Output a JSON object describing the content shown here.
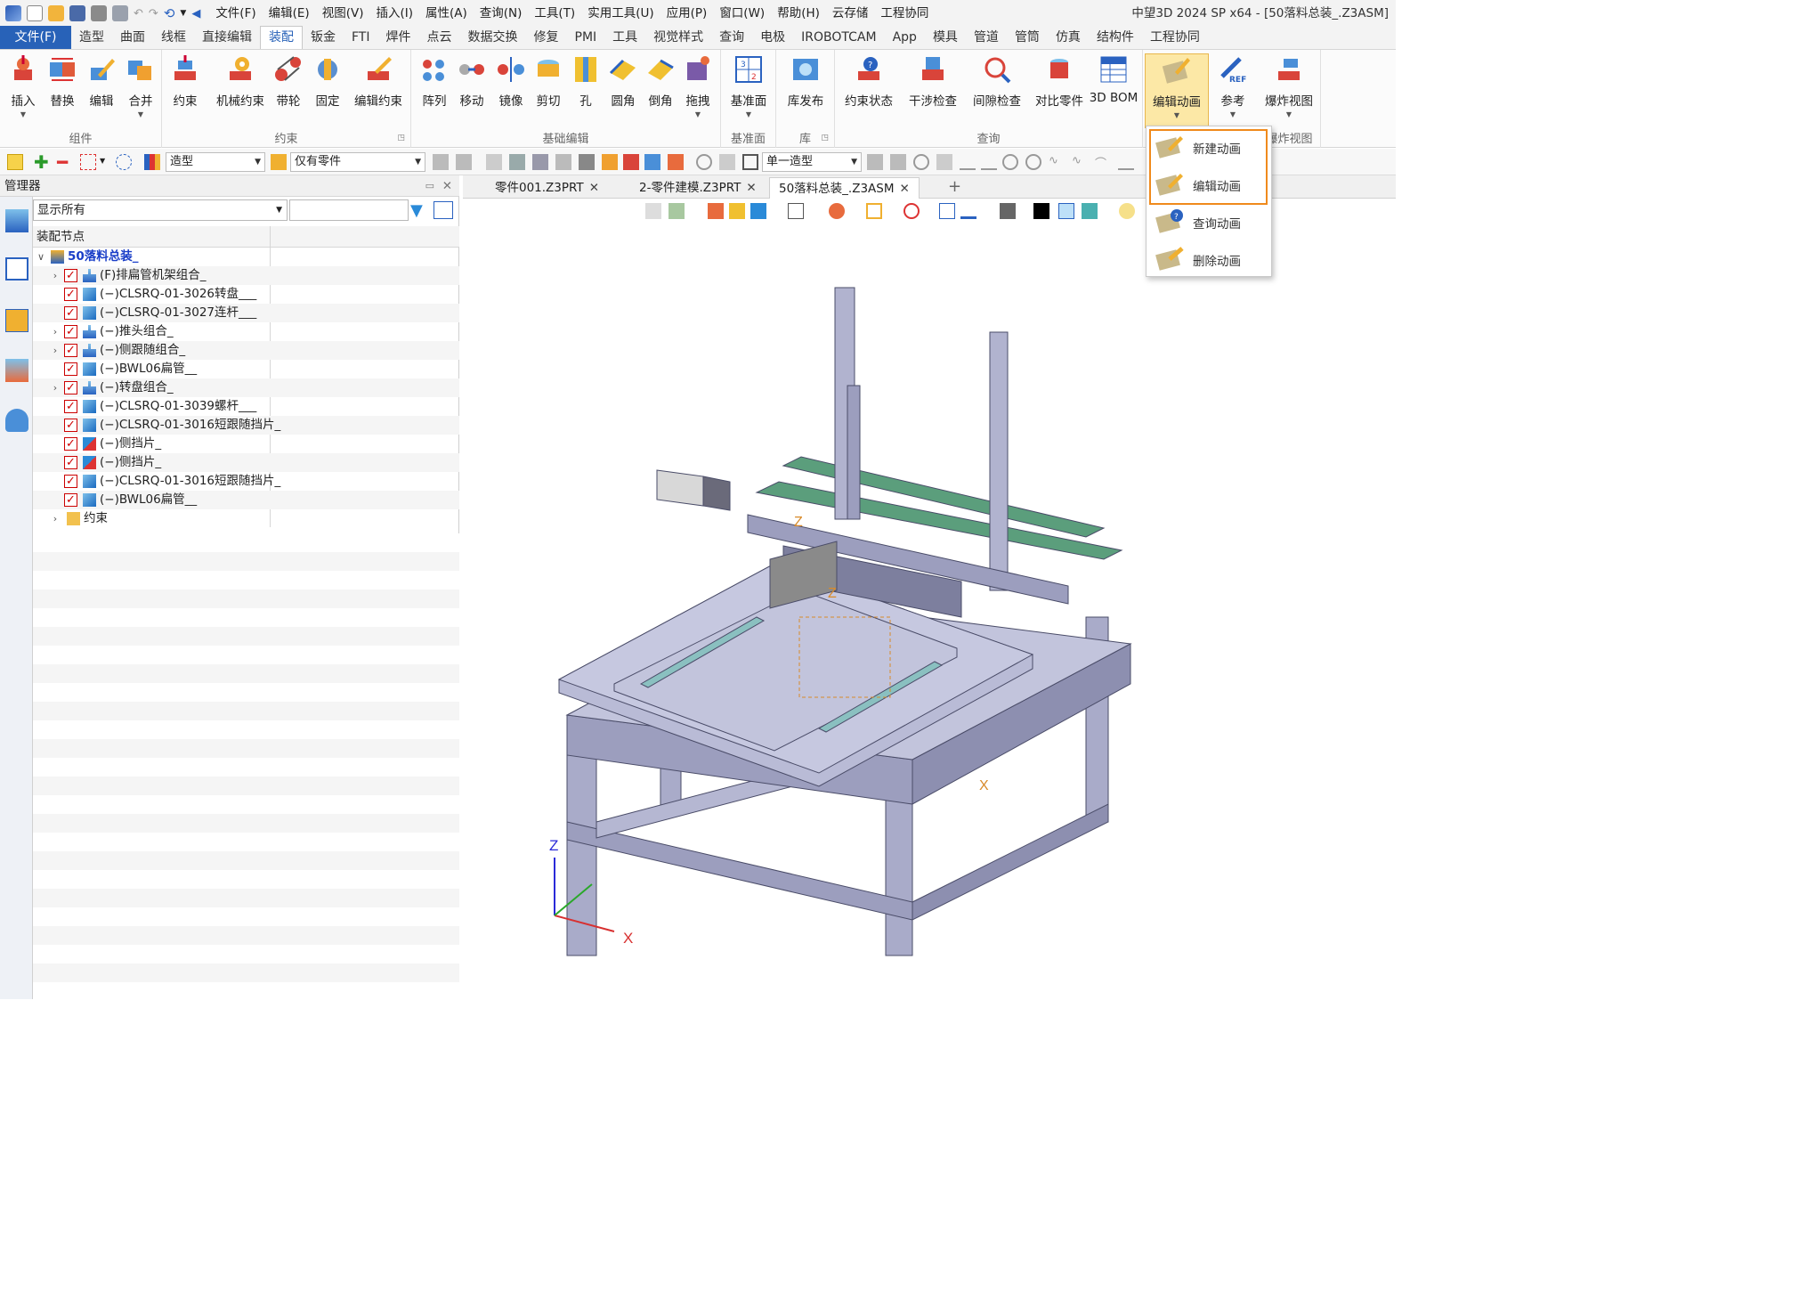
{
  "title_bar": {
    "menus": [
      "文件(F)",
      "编辑(E)",
      "视图(V)",
      "插入(I)",
      "属性(A)",
      "查询(N)",
      "工具(T)",
      "实用工具(U)",
      "应用(P)",
      "窗口(W)",
      "帮助(H)",
      "云存储",
      "工程协同"
    ],
    "window_title": "中望3D 2024 SP x64 - [50落料总装_.Z3ASM]"
  },
  "ribbon_tabs": [
    "文件(F)",
    "造型",
    "曲面",
    "线框",
    "直接编辑",
    "装配",
    "钣金",
    "FTI",
    "焊件",
    "点云",
    "数据交换",
    "修复",
    "PMI",
    "工具",
    "视觉样式",
    "查询",
    "电极",
    "IROBOTCAM",
    "App",
    "模具",
    "管道",
    "管筒",
    "仿真",
    "结构件",
    "工程协同"
  ],
  "active_tab": "装配",
  "ribbon": {
    "groups": [
      {
        "label": "组件",
        "buttons": [
          "插入",
          "替换",
          "编辑",
          "合并"
        ]
      },
      {
        "label": "约束",
        "buttons": [
          "约束",
          "机械约束",
          "带轮",
          "固定",
          "编辑约束"
        ]
      },
      {
        "label": "基础编辑",
        "buttons": [
          "阵列",
          "移动",
          "镜像",
          "剪切",
          "孔",
          "圆角",
          "倒角",
          "拖拽"
        ]
      },
      {
        "label": "基准面",
        "buttons": [
          "基准面"
        ]
      },
      {
        "label": "库",
        "buttons": [
          "库发布"
        ]
      },
      {
        "label": "查询",
        "buttons": [
          "约束状态",
          "干涉检查",
          "间隙检查",
          "对比零件",
          "3D BOM"
        ]
      },
      {
        "label": "",
        "buttons": [
          "编辑动画",
          "参考",
          "爆炸视图"
        ]
      }
    ],
    "exploded_view_group_label": "爆炸视图"
  },
  "toolbar": {
    "mode_combo": "造型",
    "filter_combo": "仅有零件",
    "select_combo": "单一造型"
  },
  "manager": {
    "title": "管理器",
    "filter": "显示所有",
    "column_header": "装配节点",
    "root": "50落料总装_",
    "nodes": [
      {
        "label": "(F)排扁管机架组合_",
        "type": "assembly",
        "expandable": true
      },
      {
        "label": "(−)CLSRQ-01-3026转盘___",
        "type": "part",
        "expandable": false
      },
      {
        "label": "(−)CLSRQ-01-3027连杆___",
        "type": "part",
        "expandable": false
      },
      {
        "label": "(−)推头组合_",
        "type": "assembly",
        "expandable": true
      },
      {
        "label": "(−)侧跟随组合_",
        "type": "assembly",
        "expandable": true
      },
      {
        "label": "(−)BWL06扁管__",
        "type": "part",
        "expandable": false
      },
      {
        "label": "(−)转盘组合_",
        "type": "assembly",
        "expandable": true
      },
      {
        "label": "(−)CLSRQ-01-3039螺杆___",
        "type": "part",
        "expandable": false
      },
      {
        "label": "(−)CLSRQ-01-3016短跟随挡片_",
        "type": "part",
        "expandable": false
      },
      {
        "label": "(−)侧挡片_",
        "type": "part2",
        "expandable": false
      },
      {
        "label": "(−)侧挡片_",
        "type": "part2",
        "expandable": false
      },
      {
        "label": "(−)CLSRQ-01-3016短跟随挡片_",
        "type": "part",
        "expandable": false
      },
      {
        "label": "(−)BWL06扁管__",
        "type": "part",
        "expandable": false
      }
    ],
    "constraints_folder": "约束"
  },
  "doc_tabs": [
    {
      "label": "零件001.Z3PRT",
      "active": false
    },
    {
      "label": "2-零件建模.Z3PRT",
      "active": false
    },
    {
      "label": "50落料总装_.Z3ASM",
      "active": true
    }
  ],
  "dropdown": {
    "items": [
      "新建动画",
      "编辑动画",
      "查询动画",
      "删除动画"
    ]
  },
  "axes": {
    "z": "Z",
    "x": "X"
  },
  "colors": {
    "accent": "#2862b8",
    "highlight": "#f08a1c",
    "machine": "#a9abc9"
  }
}
